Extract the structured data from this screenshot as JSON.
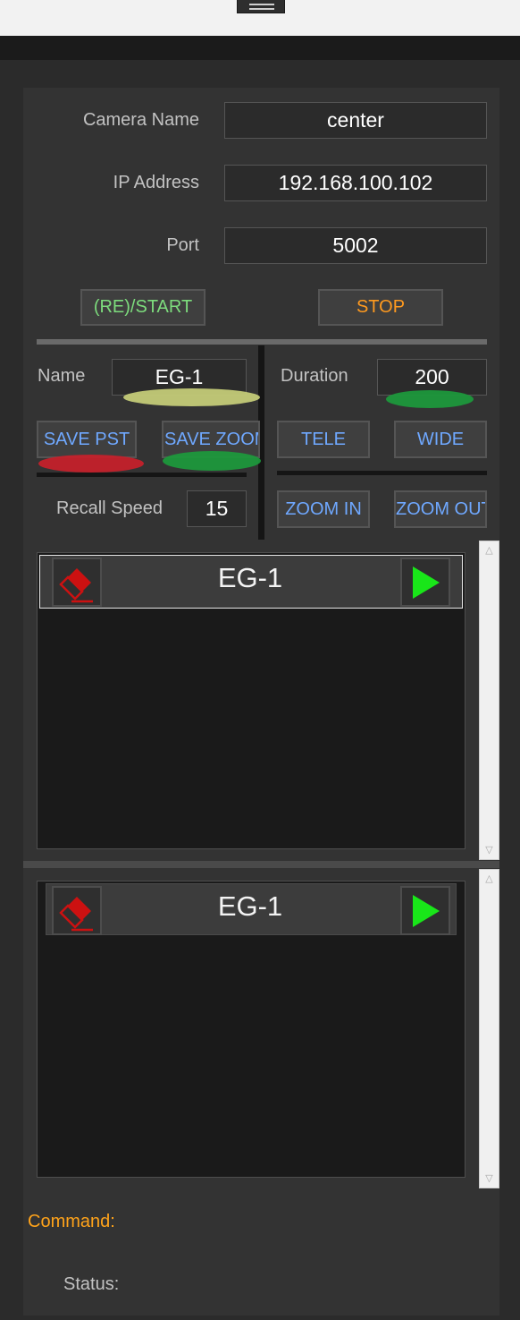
{
  "camera": {
    "name_label": "Camera Name",
    "name_value": "center",
    "ip_label": "IP Address",
    "ip_value": "192.168.100.102",
    "port_label": "Port",
    "port_value": "5002",
    "start_label": "(RE)/START",
    "stop_label": "STOP"
  },
  "preset_editor": {
    "name_label": "Name",
    "name_value": "EG-1",
    "duration_label": "Duration",
    "duration_value": "200",
    "save_pst_label": "SAVE PST",
    "save_zoom_label": "SAVE ZOOM",
    "tele_label": "TELE",
    "wide_label": "WIDE",
    "recall_speed_label": "Recall Speed",
    "recall_speed_value": "15",
    "zoom_in_label": "ZOOM IN",
    "zoom_out_label": "ZOOM OUT"
  },
  "lists": [
    {
      "items": [
        {
          "name": "EG-1",
          "selected": true
        }
      ]
    },
    {
      "items": [
        {
          "name": "EG-1",
          "selected": false
        }
      ]
    }
  ],
  "footer": {
    "command_label": "Command:",
    "status_label": "Status:"
  },
  "icons": {
    "menu": "hamburger-icon",
    "delete": "eraser-icon",
    "play": "play-icon",
    "scroll_up": "chevron-up-icon",
    "scroll_down": "chevron-down-icon"
  },
  "colors": {
    "background": "#2b2b2b",
    "panel": "#333333",
    "start_text": "#7ddc7d",
    "stop_text": "#ff9a1f",
    "blue_text": "#6fa8ff",
    "command_text": "#ffa31a",
    "play_green": "#19e619",
    "eraser_red": "#cc1111"
  }
}
